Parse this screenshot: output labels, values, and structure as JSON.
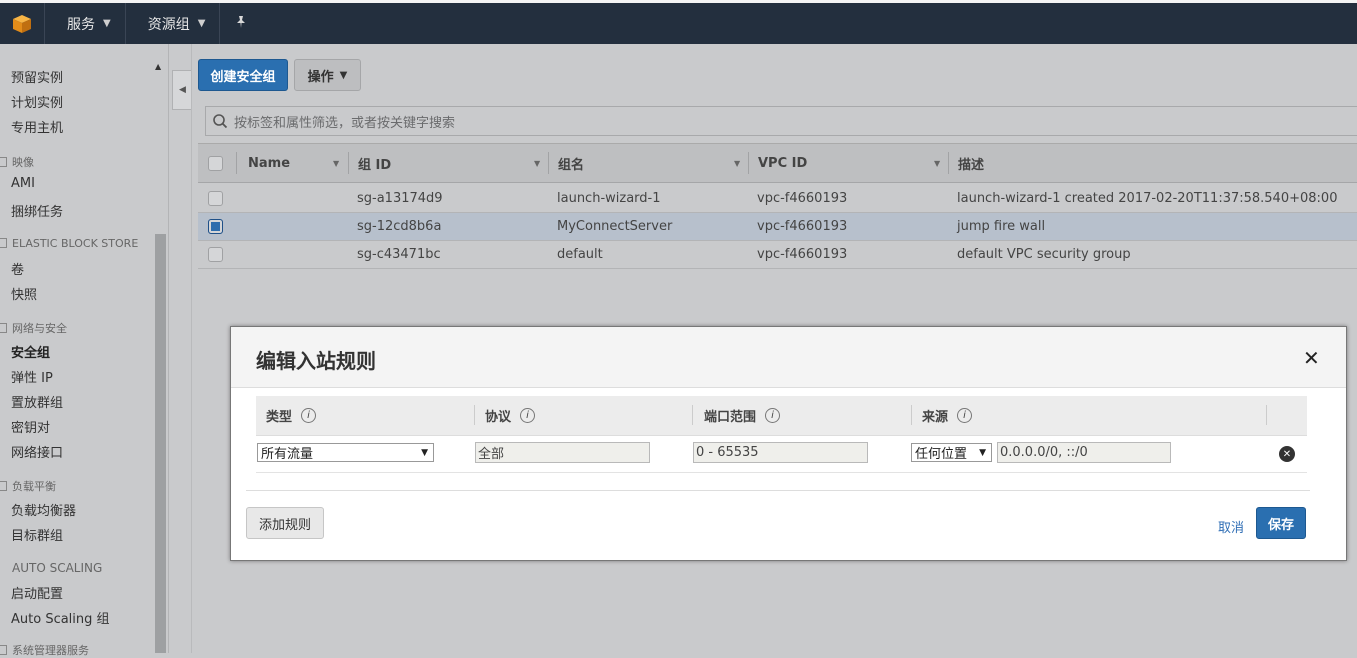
{
  "topbar": {
    "logo_icon": "aws-cube-icon",
    "services_label": "服务",
    "resource_groups_label": "资源组",
    "pin_icon": "pin-icon"
  },
  "sidebar": {
    "items_top": [
      "预留实例",
      "计划实例",
      "专用主机"
    ],
    "sections": [
      {
        "title": "映像",
        "items": [
          "AMI",
          "捆绑任务"
        ]
      },
      {
        "title": "ELASTIC BLOCK STORE",
        "items": [
          "卷",
          "快照"
        ]
      },
      {
        "title": "网络与安全",
        "items": [
          "安全组",
          "弹性 IP",
          "置放群组",
          "密钥对",
          "网络接口"
        ]
      },
      {
        "title": "负载平衡",
        "items": [
          "负载均衡器",
          "目标群组"
        ]
      },
      {
        "title": "AUTO SCALING",
        "items": [
          "启动配置",
          "Auto Scaling 组"
        ]
      },
      {
        "title": "系统管理器服务",
        "items": []
      }
    ],
    "active_item": "安全组"
  },
  "toolbar": {
    "create_label": "创建安全组",
    "actions_label": "操作"
  },
  "search": {
    "placeholder": "按标签和属性筛选，或者按关键字搜索"
  },
  "table": {
    "columns": [
      "Name",
      "组 ID",
      "组名",
      "VPC ID",
      "描述"
    ],
    "rows": [
      {
        "name": "",
        "group_id": "sg-a13174d9",
        "group_name": "launch-wizard-1",
        "vpc_id": "vpc-f4660193",
        "description": "launch-wizard-1 created 2017-02-20T11:37:58.540+08:00",
        "selected": false
      },
      {
        "name": "",
        "group_id": "sg-12cd8b6a",
        "group_name": "MyConnectServer",
        "vpc_id": "vpc-f4660193",
        "description": "jump fire wall",
        "selected": true
      },
      {
        "name": "",
        "group_id": "sg-c43471bc",
        "group_name": "default",
        "vpc_id": "vpc-f4660193",
        "description": "default VPC security group",
        "selected": false
      }
    ]
  },
  "modal": {
    "title": "编辑入站规则",
    "columns": [
      "类型",
      "协议",
      "端口范围",
      "来源"
    ],
    "rule": {
      "type": "所有流量",
      "protocol": "全部",
      "port_range": "0 - 65535",
      "source_type": "任何位置",
      "source_value": "0.0.0.0/0, ::/0"
    },
    "add_rule_label": "添加规则",
    "cancel_label": "取消",
    "save_label": "保存"
  },
  "colors": {
    "primary_button": "#2a6fb0",
    "topbar": "#232f3e",
    "link": "#2f6eb5",
    "selected_row": "#b7c0cc"
  }
}
